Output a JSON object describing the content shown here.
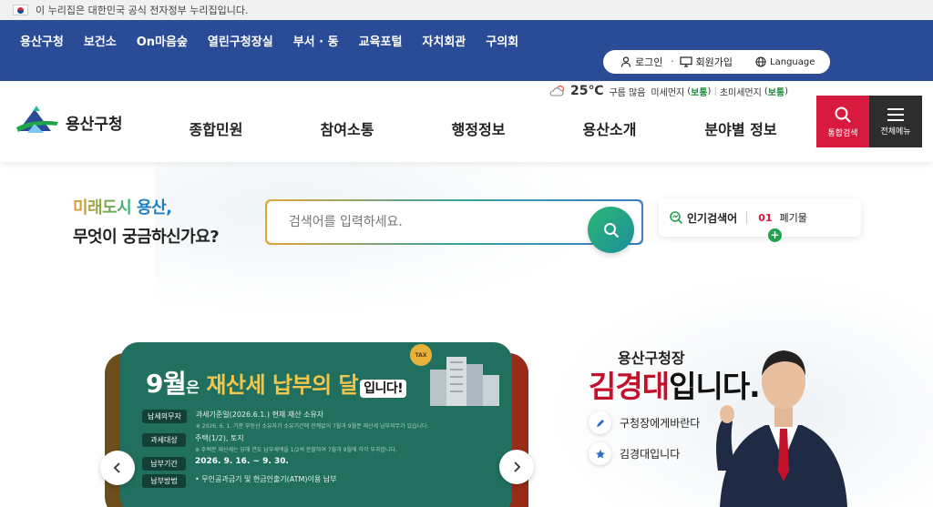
{
  "gov_bar": {
    "text": "이 누리집은 대한민국 공식 전자정부 누리집입니다."
  },
  "top_nav": {
    "links": [
      "용산구청",
      "보건소",
      "On마음숲",
      "열린구청장실",
      "부서 · 동",
      "교육포털",
      "자치회관",
      "구의회"
    ]
  },
  "utility": {
    "login": "로그인",
    "signup": "회원가입",
    "language": "Language"
  },
  "brand": {
    "name": "용산구청"
  },
  "weather": {
    "temp": "25℃",
    "condition": "구름 많음",
    "fine_dust_label": "미세먼지",
    "fine_dust_value": "보통",
    "ultrafine_dust_label": "초미세먼지",
    "ultrafine_dust_value": "보통"
  },
  "main_nav": [
    "종합민원",
    "참여소통",
    "행정정보",
    "용산소개",
    "분야별 정보"
  ],
  "header_buttons": {
    "search": "통합검색",
    "menu": "전체메뉴"
  },
  "slogan": {
    "line1_a": "미래도시",
    "line1_b": "용산,",
    "line2": "무엇이 궁금하신가요?"
  },
  "search": {
    "placeholder": "검색어를 입력하세요."
  },
  "popular": {
    "title": "인기검색어",
    "rank": "01",
    "keyword": "폐기물"
  },
  "banner": {
    "title_month": "9월",
    "title_mid": "은",
    "title_main": "재산세 납부의 달",
    "title_end": "입니다!",
    "tax_icon": "TAX",
    "rows": [
      {
        "tag": "납세의무자",
        "value": "과세기준일(2026.6.1.) 현재 재산 소유자",
        "note": "※ 2026. 6. 1. 기준 부동산 소유자가 소유기간에 관계없이 7월과 9월분 재산세 납부의무가 있습니다."
      },
      {
        "tag": "과세대상",
        "value": "주택(1/2), 토지",
        "note": "※ 주택분 재산세는 당해 연도 납부세액을 1/2씩 분할하여 7월과 9월에 각각 부과합니다."
      },
      {
        "tag": "납부기간",
        "value": "2026. 9. 16. ~ 9. 30.",
        "note": ""
      },
      {
        "tag": "납부방법",
        "value": "• 무인공과금기 및 현금인출기(ATM)이용 납부",
        "note": ""
      }
    ]
  },
  "mayor": {
    "title": "용산구청장",
    "name_red": "김경대",
    "name_end": "입니다.",
    "link1": "구청장에게바란다",
    "link2": "김경대입니다"
  },
  "colors": {
    "nav_blue": "#2a4b96",
    "accent_red": "#d71a3e",
    "banner_green": "#21705f",
    "search_green": "#2bb673"
  },
  "icons": [
    "flag-icon",
    "user-icon",
    "monitor-icon",
    "globe-icon",
    "cloud-sun-icon",
    "magnifier-icon",
    "hamburger-icon",
    "chevron-left-icon",
    "chevron-right-icon",
    "pencil-icon",
    "star-icon",
    "plus-icon"
  ]
}
